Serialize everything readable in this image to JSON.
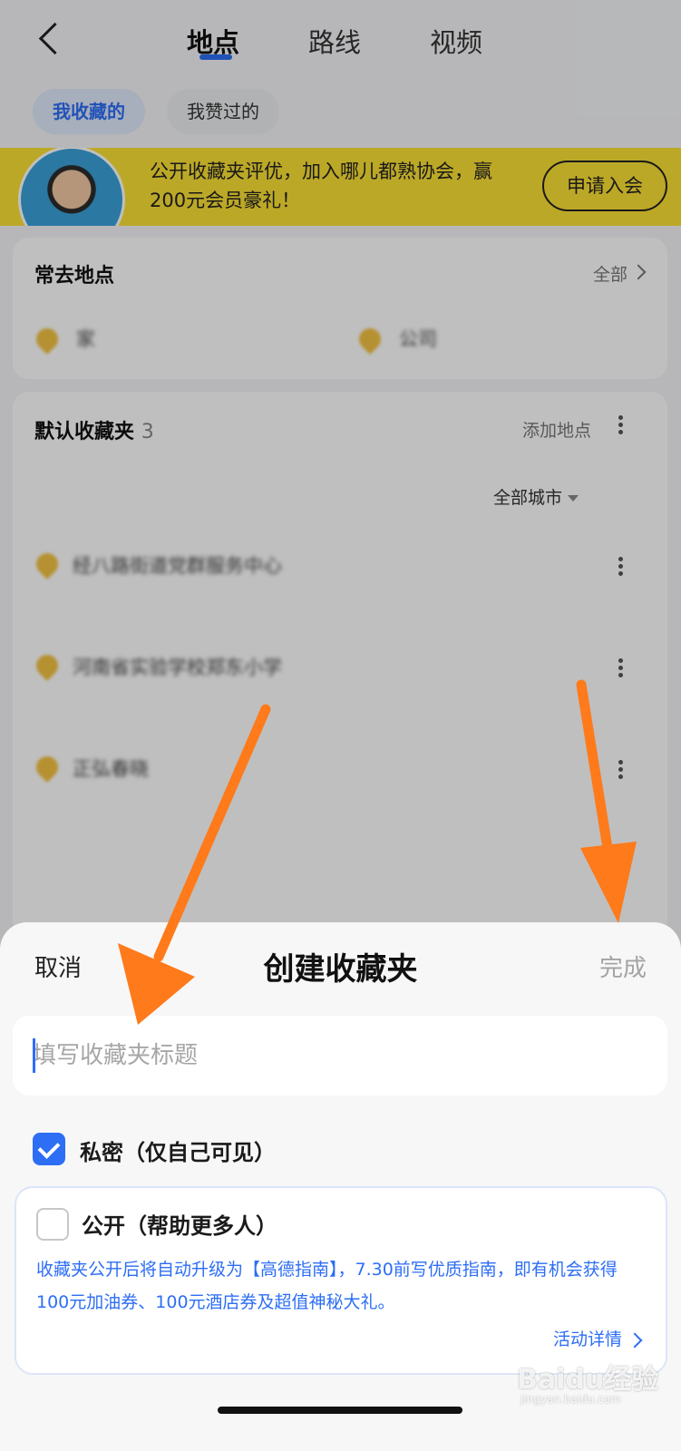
{
  "nav": {
    "tabs": [
      "地点",
      "路线",
      "视频"
    ]
  },
  "chips": {
    "active": "我收藏的",
    "inactive": "我赞过的"
  },
  "banner": {
    "text": "公开收藏夹评优，加入哪儿都熟协会，赢200元会员豪礼！",
    "button": "申请入会"
  },
  "frequent": {
    "title": "常去地点",
    "all_label": "全部",
    "places": [
      "家",
      "公司"
    ]
  },
  "folder": {
    "title": "默认收藏夹",
    "count": "3",
    "add_label": "添加地点",
    "filter_city": "全部城市",
    "items": [
      {
        "name": "经八路街道党群服务中心"
      },
      {
        "name": "河南省实验学校郑东小学"
      },
      {
        "name": "正弘春晓"
      }
    ]
  },
  "sheet": {
    "cancel": "取消",
    "title": "创建收藏夹",
    "done": "完成",
    "input_placeholder": "填写收藏夹标题",
    "private_label": "私密（仅自己可见）",
    "public_label": "公开（帮助更多人）",
    "public_desc": "收藏夹公开后将自动升级为【高德指南】，7.30前写优质指南，即有机会获得100元加油券、100元酒店券及超值神秘大礼。",
    "activity_link": "活动详情",
    "private_checked": true,
    "public_checked": false
  },
  "watermark": {
    "main": "Baidu经验",
    "sub": "jingyan.baidu.com"
  },
  "colors": {
    "accent": "#2d6ef5",
    "banner": "#fbe135",
    "arrow": "#ff7a1a"
  }
}
